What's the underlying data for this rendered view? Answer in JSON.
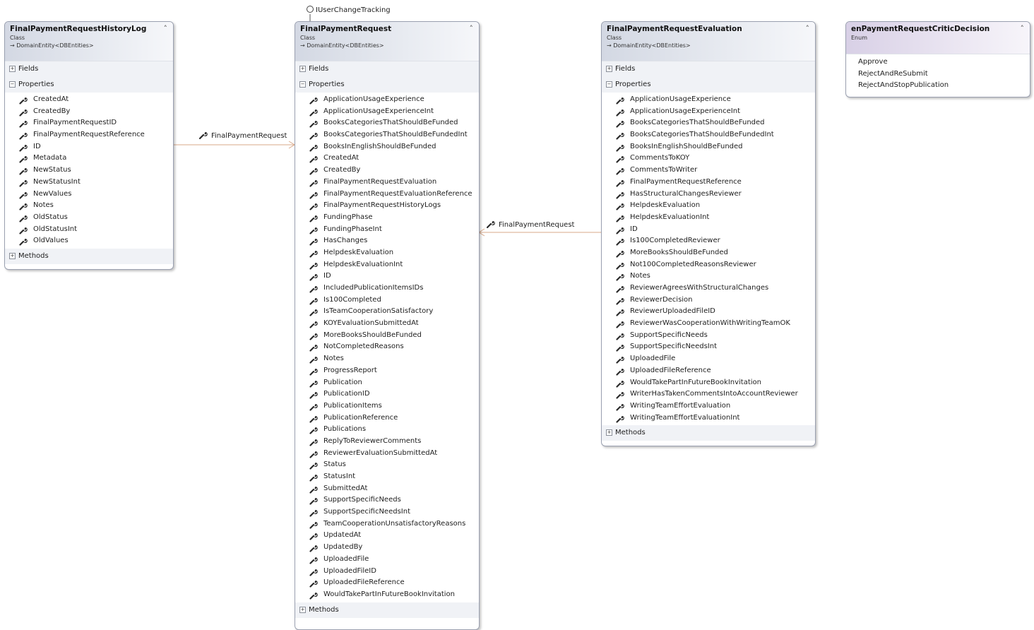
{
  "colors": {
    "class_header": "#d3d8e3",
    "enum_header": "#d8d0e6",
    "connector": "#d9a98a",
    "border": "#9aa0b0"
  },
  "icons": {
    "property": "wrench-icon",
    "collapse": "double-chevron-up-icon",
    "expand_section": "plus-box-icon",
    "collapse_section": "minus-box-icon",
    "interface": "lollipop-interface-icon"
  },
  "interface_label": "IUserChangeTracking",
  "history_log": {
    "name": "FinalPaymentRequestHistoryLog",
    "stereotype": "Class",
    "base": "→ DomainEntity<DBEntities>",
    "fields_label": "Fields",
    "properties_label": "Properties",
    "methods_label": "Methods",
    "properties": [
      "CreatedAt",
      "CreatedBy",
      "FinalPaymentRequestID",
      "FinalPaymentRequestReference",
      "ID",
      "Metadata",
      "NewStatus",
      "NewStatusInt",
      "NewValues",
      "Notes",
      "OldStatus",
      "OldStatusInt",
      "OldValues"
    ]
  },
  "payment_request": {
    "name": "FinalPaymentRequest",
    "stereotype": "Class",
    "base": "→ DomainEntity<DBEntities>",
    "fields_label": "Fields",
    "properties_label": "Properties",
    "methods_label": "Methods",
    "properties": [
      "ApplicationUsageExperience",
      "ApplicationUsageExperienceInt",
      "BooksCategoriesThatShouldBeFunded",
      "BooksCategoriesThatShouldBeFundedInt",
      "BooksInEnglishShouldBeFunded",
      "CreatedAt",
      "CreatedBy",
      "FinalPaymentRequestEvaluation",
      "FinalPaymentRequestEvaluationReference",
      "FinalPaymentRequestHistoryLogs",
      "FundingPhase",
      "FundingPhaseInt",
      "HasChanges",
      "HelpdeskEvaluation",
      "HelpdeskEvaluationInt",
      "ID",
      "IncludedPublicationItemsIDs",
      "Is100Completed",
      "IsTeamCooperationSatisfactory",
      "KOYEvaluationSubmittedAt",
      "MoreBooksShouldBeFunded",
      "NotCompletedReasons",
      "Notes",
      "ProgressReport",
      "Publication",
      "PublicationID",
      "PublicationItems",
      "PublicationReference",
      "Publications",
      "ReplyToReviewerComments",
      "ReviewerEvaluationSubmittedAt",
      "Status",
      "StatusInt",
      "SubmittedAt",
      "SupportSpecificNeeds",
      "SupportSpecificNeedsInt",
      "TeamCooperationUnsatisfactoryReasons",
      "UpdatedAt",
      "UpdatedBy",
      "UploadedFile",
      "UploadedFileID",
      "UploadedFileReference",
      "WouldTakePartInFutureBookInvitation"
    ]
  },
  "evaluation": {
    "name": "FinalPaymentRequestEvaluation",
    "stereotype": "Class",
    "base": "→ DomainEntity<DBEntities>",
    "fields_label": "Fields",
    "properties_label": "Properties",
    "methods_label": "Methods",
    "properties": [
      "ApplicationUsageExperience",
      "ApplicationUsageExperienceInt",
      "BooksCategoriesThatShouldBeFunded",
      "BooksCategoriesThatShouldBeFundedInt",
      "BooksInEnglishShouldBeFunded",
      "CommentsToKOY",
      "CommentsToWriter",
      "FinalPaymentRequestReference",
      "HasStructuralChangesReviewer",
      "HelpdeskEvaluation",
      "HelpdeskEvaluationInt",
      "ID",
      "Is100CompletedReviewer",
      "MoreBooksShouldBeFunded",
      "Not100CompletedReasonsReviewer",
      "Notes",
      "ReviewerAgreesWithStructuralChanges",
      "ReviewerDecision",
      "ReviewerUploadedFileID",
      "ReviewerWasCooperationWithWritingTeamOK",
      "SupportSpecificNeeds",
      "SupportSpecificNeedsInt",
      "UploadedFile",
      "UploadedFileReference",
      "WouldTakePartInFutureBookInvitation",
      "WriterHasTakenCommentsIntoAccountReviewer",
      "WritingTeamEffortEvaluation",
      "WritingTeamEffortEvaluationInt"
    ]
  },
  "critic_enum": {
    "name": "enPaymentRequestCriticDecision",
    "stereotype": "Enum",
    "values": [
      "Approve",
      "RejectAndReSubmit",
      "RejectAndStopPublication"
    ]
  },
  "connectors": {
    "log_to_request": "FinalPaymentRequest",
    "evaluation_to_request": "FinalPaymentRequest"
  }
}
